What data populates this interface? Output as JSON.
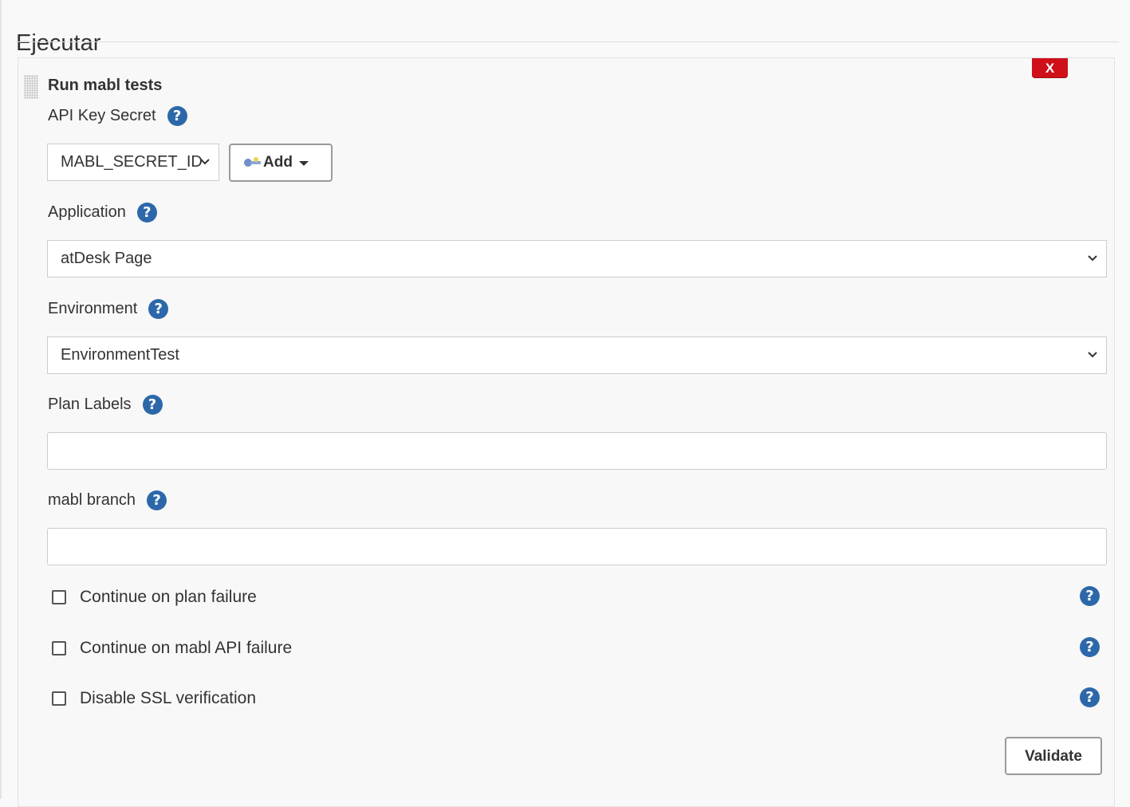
{
  "section": {
    "title": "Ejecutar"
  },
  "step": {
    "title": "Run mabl tests",
    "delete_label": "X",
    "validate_label": "Validate"
  },
  "fields": {
    "api_key": {
      "label": "API Key Secret",
      "selected": "MABL_SECRET_ID",
      "add_label": "Add"
    },
    "application": {
      "label": "Application",
      "selected": "atDesk Page"
    },
    "environment": {
      "label": "Environment",
      "selected": "EnvironmentTest"
    },
    "plan_labels": {
      "label": "Plan Labels",
      "value": ""
    },
    "mabl_branch": {
      "label": "mabl branch",
      "value": ""
    }
  },
  "checkboxes": [
    {
      "label": "Continue on plan failure",
      "checked": false
    },
    {
      "label": "Continue on mabl API failure",
      "checked": false
    },
    {
      "label": "Disable SSL verification",
      "checked": false
    }
  ],
  "help_glyph": "?",
  "colors": {
    "help": "#2c68a9",
    "delete": "#cf1019",
    "border": "#cccccc"
  }
}
